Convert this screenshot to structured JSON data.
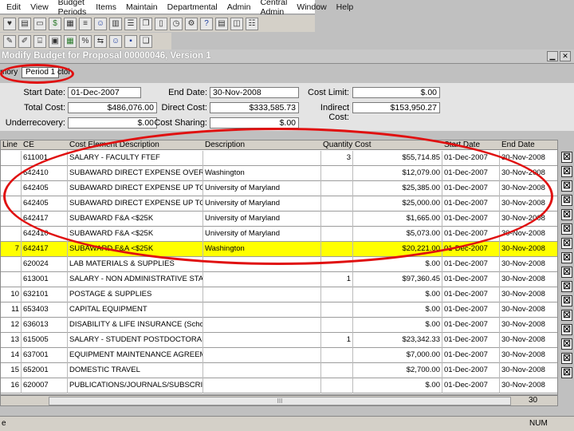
{
  "menu": [
    "Edit",
    "View",
    "Budget Periods",
    "Items",
    "Maintain",
    "Departmental",
    "Admin",
    "Central Admin",
    "Window",
    "Help"
  ],
  "toolbar1": [
    {
      "icon": "save-icon",
      "glyph": "♥",
      "tone": ""
    },
    {
      "icon": "print-icon",
      "glyph": "▤",
      "tone": ""
    },
    {
      "icon": "folder-icon",
      "glyph": "▭",
      "tone": ""
    },
    {
      "icon": "money-icon",
      "glyph": "$",
      "tone": "g"
    },
    {
      "icon": "calculator-icon",
      "glyph": "▦",
      "tone": ""
    },
    {
      "icon": "report-icon",
      "glyph": "≡",
      "tone": ""
    },
    {
      "icon": "people-icon",
      "glyph": "☺",
      "tone": "b"
    },
    {
      "icon": "chart-icon",
      "glyph": "▥",
      "tone": ""
    },
    {
      "icon": "list-icon",
      "glyph": "☰",
      "tone": ""
    },
    {
      "icon": "copy-icon",
      "glyph": "❐",
      "tone": ""
    },
    {
      "icon": "window-icon",
      "glyph": "▯",
      "tone": ""
    },
    {
      "icon": "clock-icon",
      "glyph": "◷",
      "tone": ""
    },
    {
      "icon": "gear-icon",
      "glyph": "⚙",
      "tone": ""
    },
    {
      "icon": "help-icon",
      "glyph": "?",
      "tone": "b"
    },
    {
      "icon": "tile-icon",
      "glyph": "▤",
      "tone": ""
    },
    {
      "icon": "split-icon",
      "glyph": "◫",
      "tone": ""
    },
    {
      "icon": "stack-icon",
      "glyph": "☷",
      "tone": ""
    }
  ],
  "toolbar2": [
    {
      "icon": "new-icon",
      "glyph": "✎",
      "tone": ""
    },
    {
      "icon": "edit-icon",
      "glyph": "✐",
      "tone": ""
    },
    {
      "icon": "attach-icon",
      "glyph": "⌸",
      "tone": ""
    },
    {
      "icon": "package-icon",
      "glyph": "▣",
      "tone": ""
    },
    {
      "icon": "details-icon",
      "glyph": "▦",
      "tone": "g"
    },
    {
      "icon": "percent-icon",
      "glyph": "%",
      "tone": ""
    },
    {
      "icon": "transfer-icon",
      "glyph": "⇆",
      "tone": ""
    },
    {
      "icon": "people-icon",
      "glyph": "☺",
      "tone": "b"
    },
    {
      "icon": "disk-icon",
      "glyph": "▪",
      "tone": "b"
    },
    {
      "icon": "document-icon",
      "glyph": "❏",
      "tone": ""
    }
  ],
  "window": {
    "title": "Modify Budget for Proposal 00000046, Version 1"
  },
  "tabs": {
    "left": "mory",
    "selected": "Period 1",
    "right": "ctol"
  },
  "header": {
    "start_date_label": "Start Date:",
    "start_date": "01-Dec-2007",
    "end_date_label": "End Date:",
    "end_date": "30-Nov-2008",
    "cost_limit_label": "Cost Limit:",
    "cost_limit": "$.00",
    "total_cost_label": "Total Cost:",
    "total_cost": "$486,076.00",
    "direct_cost_label": "Direct Cost:",
    "direct_cost": "$333,585.73",
    "indirect_cost_label": "Indirect Cost:",
    "indirect_cost": "$153,950.27",
    "underrecovery_label": "Underrecovery:",
    "underrecovery": "$.00",
    "cost_sharing_label": "Cost Sharing:",
    "cost_sharing": "$.00"
  },
  "grid": {
    "columns": [
      "Line",
      "CE",
      "Cost Element Description",
      "Description",
      "Quantity",
      "Cost",
      "Start Date",
      "End Date"
    ],
    "rows": [
      {
        "line": "",
        "ce": "611001",
        "ced": "SALARY - FACULTY FTEF",
        "desc": "",
        "qty": "3",
        "cost": "$55,714.85",
        "start": "01-Dec-2007",
        "end": "30-Nov-2008"
      },
      {
        "line": "",
        "ce": "642410",
        "ced": "SUBAWARD DIRECT EXPENSE OVER $25,000",
        "desc": "Washington",
        "qty": "",
        "cost": "$12,079.00",
        "start": "01-Dec-2007",
        "end": "30-Nov-2008"
      },
      {
        "line": "",
        "ce": "642405",
        "ced": "SUBAWARD DIRECT EXPENSE UP TO $25,000",
        "desc": "University of Maryland",
        "qty": "",
        "cost": "$25,385.00",
        "start": "01-Dec-2007",
        "end": "30-Nov-2008"
      },
      {
        "line": "",
        "ce": "642405",
        "ced": "SUBAWARD DIRECT EXPENSE UP TO $25,000",
        "desc": "University of Maryland",
        "qty": "",
        "cost": "$25,000.00",
        "start": "01-Dec-2007",
        "end": "30-Nov-2008"
      },
      {
        "line": "",
        "ce": "642417",
        "ced": "SUBAWARD F&A <$25K",
        "desc": "University of Maryland",
        "qty": "",
        "cost": "$1,665.00",
        "start": "01-Dec-2007",
        "end": "30-Nov-2008"
      },
      {
        "line": "",
        "ce": "642410",
        "ced": "SUBAWARD F&A <$25K",
        "desc": "University of Maryland",
        "qty": "",
        "cost": "$5,073.00",
        "start": "01-Dec-2007",
        "end": "30-Nov-2008"
      },
      {
        "line": "7",
        "ce": "642417",
        "ced": "SUBAWARD F&A <$25K",
        "desc": "Washington",
        "qty": "",
        "cost": "$20,221.00",
        "start": "01-Dec-2007",
        "end": "30-Nov-2008",
        "selected": true
      },
      {
        "line": "",
        "ce": "620024",
        "ced": "LAB MATERIALS & SUPPLIES",
        "desc": "",
        "qty": "",
        "cost": "$.00",
        "start": "01-Dec-2007",
        "end": "30-Nov-2008"
      },
      {
        "line": "",
        "ce": "613001",
        "ced": "SALARY - NON ADMINISTRATIVE STAFF E...",
        "desc": "",
        "qty": "1",
        "cost": "$97,360.45",
        "start": "01-Dec-2007",
        "end": "30-Nov-2008"
      },
      {
        "line": "10",
        "ce": "632101",
        "ced": "POSTAGE & SUPPLIES",
        "desc": "",
        "qty": "",
        "cost": "$.00",
        "start": "01-Dec-2007",
        "end": "30-Nov-2008"
      },
      {
        "line": "11",
        "ce": "653403",
        "ced": "CAPITAL EQUIPMENT",
        "desc": "",
        "qty": "",
        "cost": "$.00",
        "start": "01-Dec-2007",
        "end": "30-Nov-2008"
      },
      {
        "line": "12",
        "ce": "636013",
        "ced": "DISABILITY & LIFE INSURANCE (School of M",
        "desc": "",
        "qty": "",
        "cost": "$.00",
        "start": "01-Dec-2007",
        "end": "30-Nov-2008"
      },
      {
        "line": "13",
        "ce": "615005",
        "ced": "SALARY - STUDENT POSTDOCTORAL",
        "desc": "",
        "qty": "1",
        "cost": "$23,342.33",
        "start": "01-Dec-2007",
        "end": "30-Nov-2008"
      },
      {
        "line": "14",
        "ce": "637001",
        "ced": "EQUIPMENT MAINTENANCE AGREEMENT",
        "desc": "",
        "qty": "",
        "cost": "$7,000.00",
        "start": "01-Dec-2007",
        "end": "30-Nov-2008"
      },
      {
        "line": "15",
        "ce": "652001",
        "ced": "DOMESTIC TRAVEL",
        "desc": "",
        "qty": "",
        "cost": "$2,700.00",
        "start": "01-Dec-2007",
        "end": "30-Nov-2008"
      },
      {
        "line": "16",
        "ce": "620007",
        "ced": "PUBLICATIONS/JOURNALS/SUBSCRIPTIONS",
        "desc": "",
        "qty": "",
        "cost": "$.00",
        "start": "01-Dec-2007",
        "end": "30-Nov-2008"
      }
    ]
  },
  "delete_glyph": "☒",
  "scroll": {
    "thumb": "III",
    "page": "30"
  },
  "status": {
    "left": "e",
    "mode": "NUM"
  },
  "annotation_color": "#e01010"
}
